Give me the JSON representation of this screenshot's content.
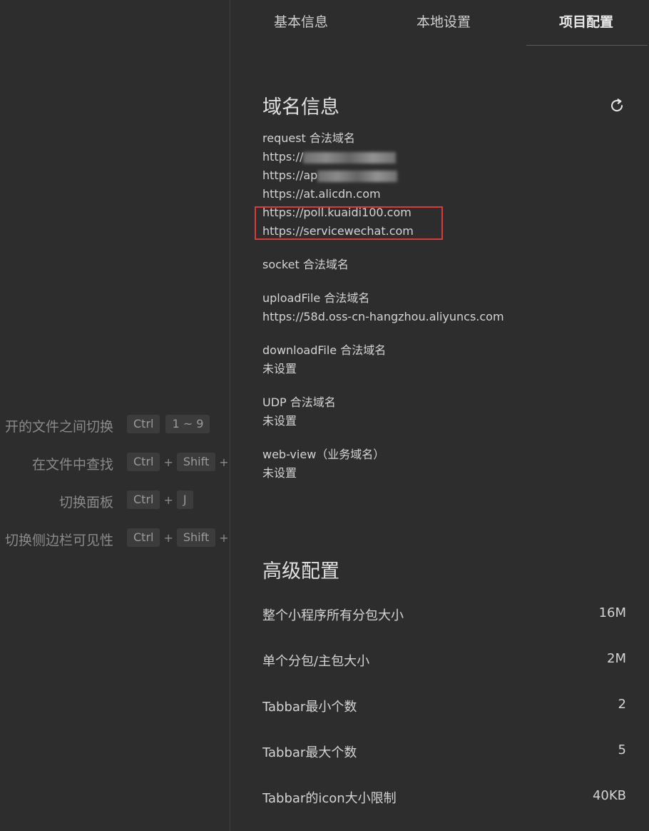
{
  "shortcuts": [
    {
      "label": "开的文件之间切换",
      "keys": [
        "Ctrl",
        "1 ~ 9"
      ]
    },
    {
      "label": "在文件中查找",
      "keys": [
        "Ctrl",
        "+",
        "Shift",
        "+"
      ]
    },
    {
      "label": "切换面板",
      "keys": [
        "Ctrl",
        "+",
        "J"
      ]
    },
    {
      "label": "切换侧边栏可见性",
      "keys": [
        "Ctrl",
        "+",
        "Shift",
        "+"
      ]
    }
  ],
  "tabs": [
    {
      "label": "基本信息"
    },
    {
      "label": "本地设置"
    },
    {
      "label": "项目配置"
    }
  ],
  "domain_info": {
    "title": "域名信息",
    "refresh_icon": "refresh-icon",
    "request": {
      "label": "request 合法域名",
      "domains": [
        "https://",
        "https://ap",
        "https://at.alicdn.com",
        "https://poll.kuaidi100.com",
        "https://servicewechat.com"
      ]
    },
    "socket": {
      "label": "socket 合法域名"
    },
    "uploadFile": {
      "label": "uploadFile 合法域名",
      "value": "https://58d.oss-cn-hangzhou.aliyuncs.com"
    },
    "downloadFile": {
      "label": "downloadFile 合法域名",
      "value": "未设置"
    },
    "udp": {
      "label": "UDP 合法域名",
      "value": "未设置"
    },
    "webview": {
      "label": "web-view（业务域名）",
      "value": "未设置"
    },
    "highlight_color": "#d93a3a"
  },
  "advanced": {
    "title": "高级配置",
    "rows": [
      {
        "name": "整个小程序所有分包大小",
        "value": "16M"
      },
      {
        "name": "单个分包/主包大小",
        "value": "2M"
      },
      {
        "name": "Tabbar最小个数",
        "value": "2"
      },
      {
        "name": "Tabbar最大个数",
        "value": "5"
      },
      {
        "name": "Tabbar的icon大小限制",
        "value": "40KB"
      }
    ]
  }
}
